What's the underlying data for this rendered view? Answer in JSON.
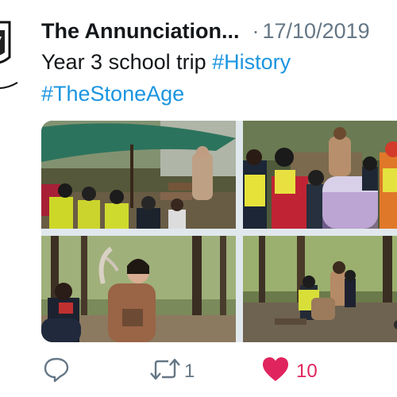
{
  "tweet": {
    "author": "The Annunciation...",
    "separator": "·",
    "date": "17/10/2019",
    "text": "Year 3 school trip",
    "hashtags": [
      "#History",
      "#TheStoneAge"
    ]
  },
  "media": {
    "photos": [
      {
        "icon": "photo-stone-age-camp"
      },
      {
        "icon": "photo-pupils-in-hi-vis"
      },
      {
        "icon": "photo-woman-holding-antler"
      },
      {
        "icon": "photo-forest-clearing"
      }
    ]
  },
  "actions": {
    "reply_icon": "reply-icon",
    "retweet_icon": "retweet-icon",
    "retweet_count": "1",
    "like_icon": "heart-icon",
    "like_count": "10",
    "like_color": "#e0245e"
  },
  "colors": {
    "hashtag": "#1b95e0",
    "muted": "#657786",
    "text": "#14171a"
  }
}
